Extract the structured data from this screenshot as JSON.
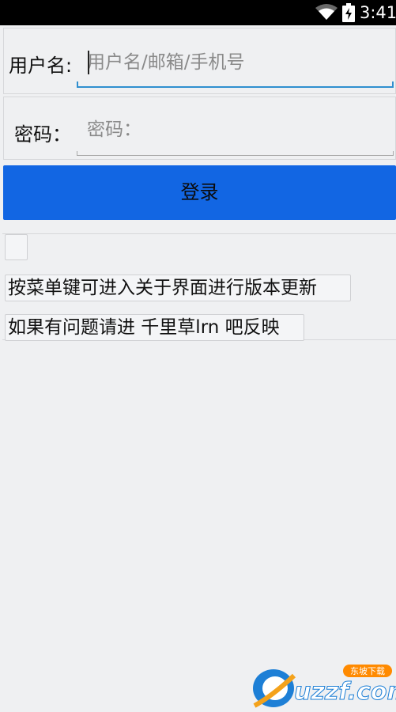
{
  "status_bar": {
    "time": "3:41"
  },
  "login_form": {
    "username_label": "用户名:",
    "username_placeholder": "用户名/邮箱/手机号",
    "password_label": "密码：",
    "password_placeholder": "密码：",
    "login_button_label": "登录"
  },
  "info": {
    "line1": "按菜单键可进入关于界面进行版本更新",
    "line2": "如果有问题请进 千里草lrn 吧反映"
  },
  "watermark": {
    "brand": "uzzf.com",
    "badge": "东坡下载"
  }
}
